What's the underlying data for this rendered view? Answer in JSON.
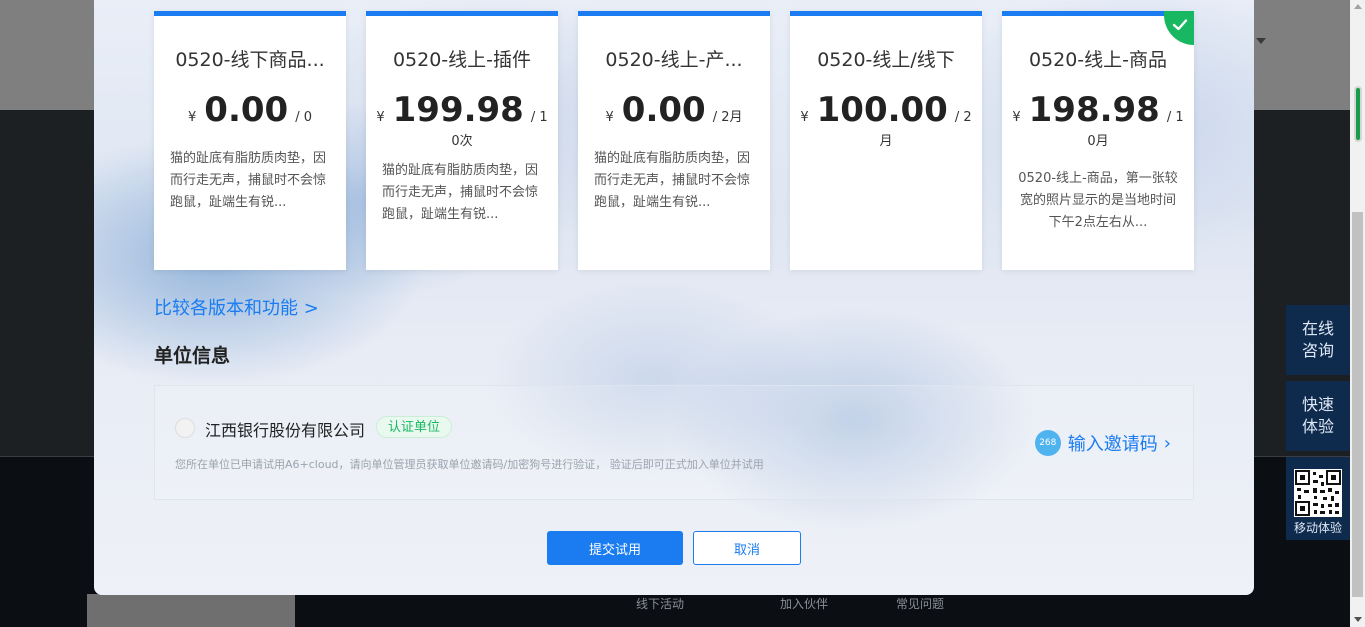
{
  "cards": [
    {
      "title": "0520-线下商品...",
      "currency": "¥",
      "amount": "0.00",
      "unit": "/ 0",
      "unit_cont": "",
      "desc": "猫的趾底有脂肪质肉垫，因而行走无声，捕鼠时不会惊跑鼠，趾端生有锐..."
    },
    {
      "title": "0520-线上-插件",
      "currency": "¥",
      "amount": "199.98",
      "unit": "/ 1",
      "unit_cont": "0次",
      "desc": "猫的趾底有脂肪质肉垫，因而行走无声，捕鼠时不会惊跑鼠，趾端生有锐..."
    },
    {
      "title": "0520-线上-产...",
      "currency": "¥",
      "amount": "0.00",
      "unit": "/ 2月",
      "unit_cont": "",
      "desc": "猫的趾底有脂肪质肉垫，因而行走无声，捕鼠时不会惊跑鼠，趾端生有锐..."
    },
    {
      "title": "0520-线上/线下",
      "currency": "¥",
      "amount": "100.00",
      "unit": "/ 2",
      "unit_cont": "月",
      "desc": ""
    },
    {
      "title": "0520-线上-商品",
      "currency": "¥",
      "amount": "198.98",
      "unit": "/ 1",
      "unit_cont": "0月",
      "desc": "0520-线上-商品，第一张较宽的照片显示的是当地时间下午2点左右从..."
    }
  ],
  "compare_link": "比较各版本和功能 >",
  "section_title": "单位信息",
  "org": {
    "name": "江西银行股份有限公司",
    "badge": "认证单位",
    "hint": "您所在单位已申请试用A6+cloud，请向单位管理员获取单位邀请码/加密狗号进行验证， 验证后即可正式加入单位并试用",
    "invite_icon_text": "268",
    "invite_label": "输入邀请码"
  },
  "buttons": {
    "submit": "提交试用",
    "cancel": "取消"
  },
  "side": {
    "consult": "在线咨询",
    "quick": "快速体验",
    "mobile": "移动体验"
  },
  "footer": {
    "link1": "线下活动",
    "link2": "加入伙伴",
    "link3": "常见问题"
  },
  "colors": {
    "accent": "#1a7cf0",
    "success": "#18b862",
    "side_bg": "#0e2a4d"
  }
}
